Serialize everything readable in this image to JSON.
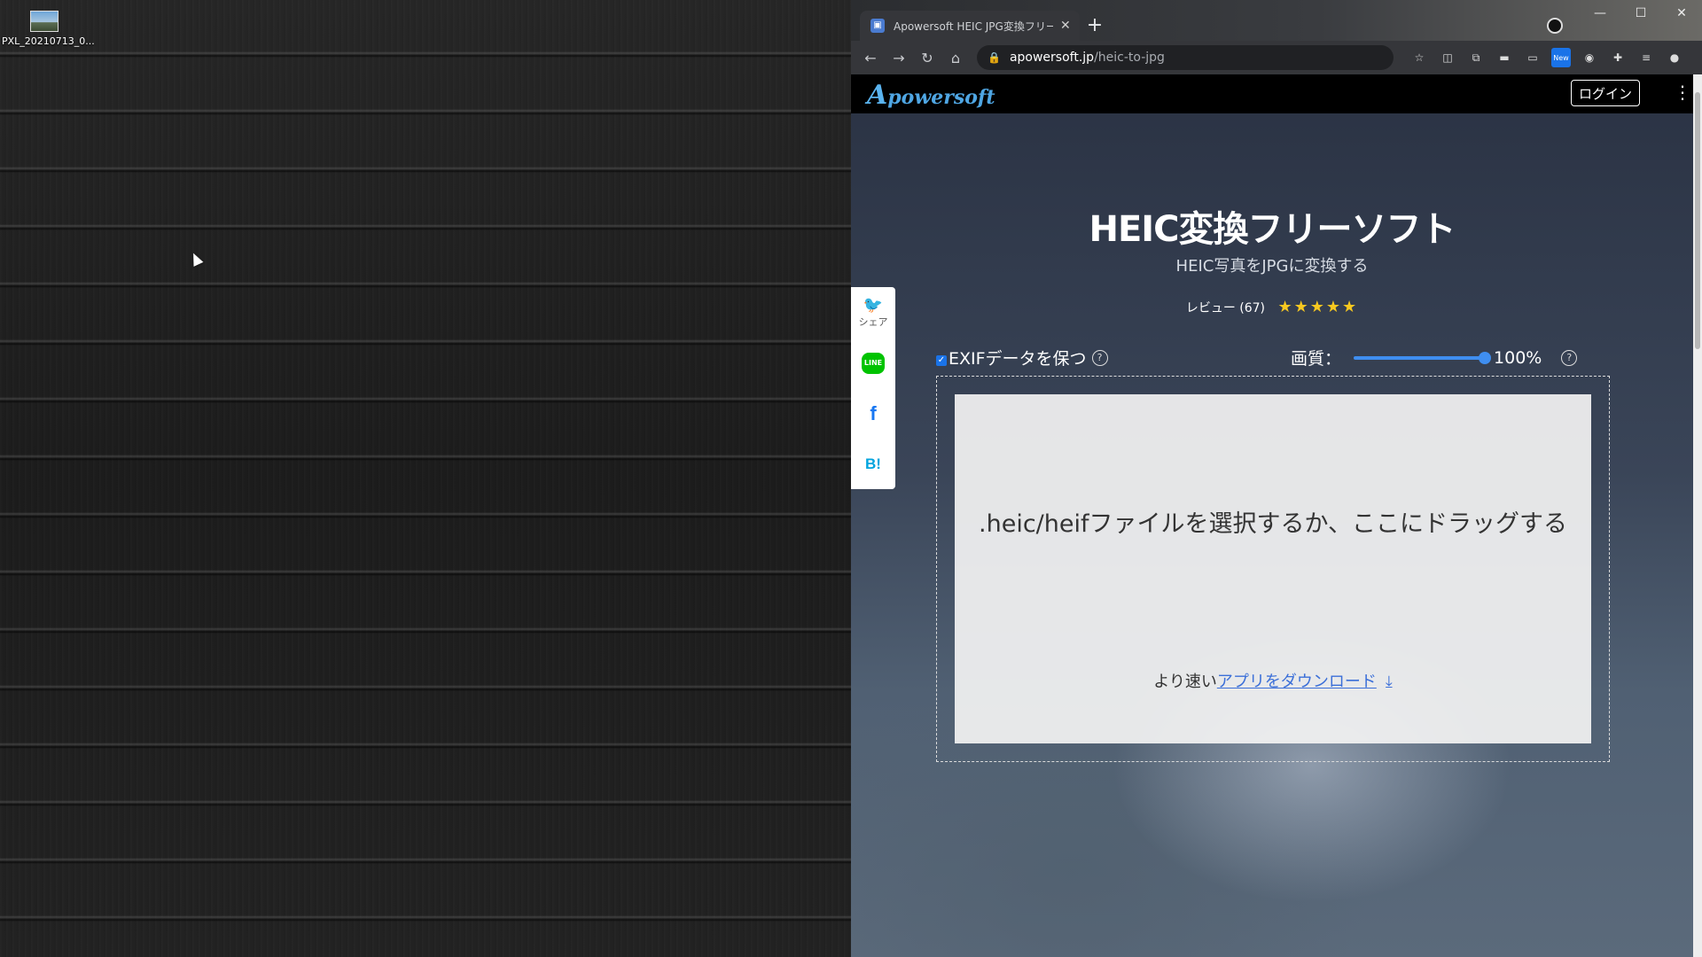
{
  "desktop": {
    "icon_label": "PXL_20210713_0..."
  },
  "browser": {
    "tab_title": "Apowersoft HEIC JPG変換フリーソ",
    "url_domain": "apowersoft.jp",
    "url_path": "/heic-to-jpg",
    "new_badge": "New"
  },
  "site": {
    "logo": "powersoft",
    "logo_letter": "A",
    "login_label": "ログイン",
    "title": "HEIC変換フリーソフト",
    "subtitle": "HEIC写真をJPGに変換する",
    "review_label": "レビュー (67)",
    "stars": "★★★★★"
  },
  "share": {
    "twitter_label": "シェア",
    "line_label": "LINE",
    "facebook_label": "f",
    "hatena_label": "B!"
  },
  "options": {
    "exif_label": "EXIFデータを保つ",
    "quality_label": "画質：",
    "quality_value": "100%",
    "quality_fraction": 1.0
  },
  "dropzone": {
    "text": ".heic/heifファイルを選択するか、ここにドラッグする",
    "prefix": "より速い",
    "link": "アプリをダウンロード"
  }
}
